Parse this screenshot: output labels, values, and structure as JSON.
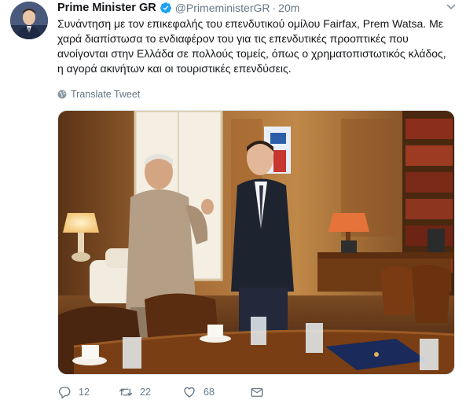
{
  "author": {
    "name": "Prime Minister GR",
    "handle": "@PrimeministerGR",
    "separator": "·",
    "time": "20m",
    "verified": true
  },
  "tweet": {
    "text_lines": [
      "Συνάντηση με τον επικεφαλής του επενδυτικού ομίλου Fairfax, Prem Watsa. Με",
      "χαρά διαπίστωσα το ενδιαφέρον του για τις επενδυτικές προοπτικές που",
      "ανοίγονται στην Ελλάδα σε πολλούς τομείς, όπως ο χρηματοπιστωτικός κλάδος,",
      "η αγορά ακινήτων και οι τουριστικές επενδύσεις."
    ],
    "translate_label": "Translate Tweet"
  },
  "actions": {
    "replies": "12",
    "retweets": "22",
    "likes": "68"
  },
  "icons": {
    "verified": "verified-badge-icon",
    "caret": "chevron-down-icon",
    "translate": "globe-icon",
    "reply": "reply-icon",
    "retweet": "retweet-icon",
    "like": "heart-icon",
    "dm": "envelope-icon"
  },
  "colors": {
    "text": "#14171a",
    "muted": "#657786",
    "verified": "#1da1f2"
  }
}
